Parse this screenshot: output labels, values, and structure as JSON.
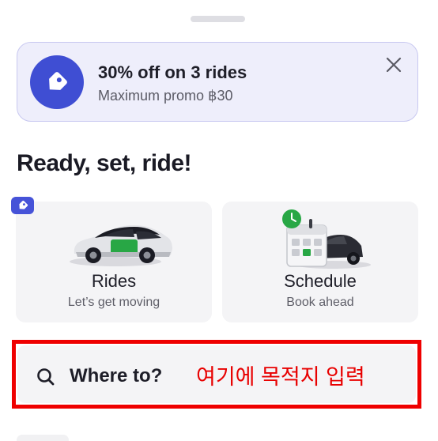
{
  "promo": {
    "title": "30% off on 3 rides",
    "subtitle": "Maximum promo ฿30",
    "badge_icon": "tag-icon",
    "close_icon": "close-icon",
    "background_color": "#eeeefb",
    "accent_color": "#3f4ed3"
  },
  "section": {
    "title": "Ready, set, ride!"
  },
  "services": [
    {
      "label": "Rides",
      "subtitle": "Let’s get moving",
      "icon": "car-icon",
      "has_promo_tag": true
    },
    {
      "label": "Schedule",
      "subtitle": "Book ahead",
      "icon": "calendar-car-icon",
      "has_promo_tag": false
    }
  ],
  "search": {
    "placeholder": "Where to?",
    "icon": "search-icon"
  },
  "annotation": {
    "text": "여기에 목적지 입력",
    "color": "#e80000"
  }
}
